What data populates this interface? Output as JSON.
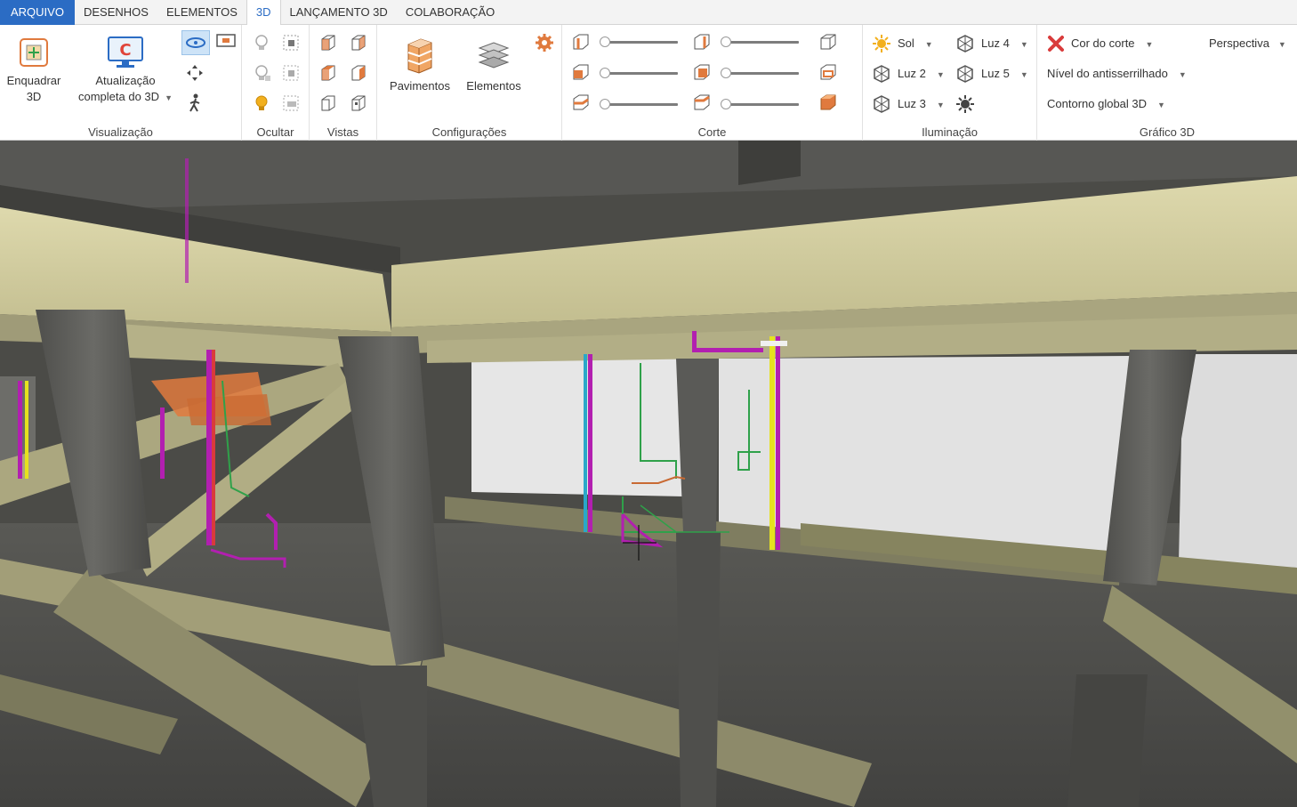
{
  "tabs": [
    {
      "label": "ARQUIVO",
      "active": false
    },
    {
      "label": "DESENHOS",
      "active": false
    },
    {
      "label": "ELEMENTOS",
      "active": false
    },
    {
      "label": "3D",
      "active": true
    },
    {
      "label": "LANÇAMENTO 3D",
      "active": false
    },
    {
      "label": "COLABORAÇÃO",
      "active": false
    }
  ],
  "ribbon": {
    "visualizacao": {
      "label": "Visualização",
      "enquadrar_line1": "Enquadrar",
      "enquadrar_line2": "3D",
      "atualizacao_line1": "Atualização",
      "atualizacao_line2": "completa do 3D"
    },
    "ocultar": {
      "label": "Ocultar"
    },
    "vistas": {
      "label": "Vistas"
    },
    "configuracoes": {
      "label": "Configurações",
      "pavimentos": "Pavimentos",
      "elementos": "Elementos"
    },
    "corte": {
      "label": "Corte"
    },
    "iluminacao": {
      "label": "Iluminação",
      "sol": "Sol",
      "luz2": "Luz 2",
      "luz3": "Luz 3",
      "luz4": "Luz 4",
      "luz5": "Luz 5"
    },
    "grafico3d": {
      "label": "Gráfico 3D",
      "cor_do_corte": "Cor do corte",
      "perspectiva": "Perspectiva",
      "antisserrilhado": "Nível do antisserrilhado",
      "contorno": "Contorno global 3D"
    }
  },
  "colors": {
    "accent": "#2b6cc4",
    "beam": "#c9c59a",
    "pipe_magenta": "#b21fb0",
    "pipe_yellow": "#e6e21e",
    "pipe_green": "#2fa14a",
    "stair_orange": "#e07a3e"
  }
}
